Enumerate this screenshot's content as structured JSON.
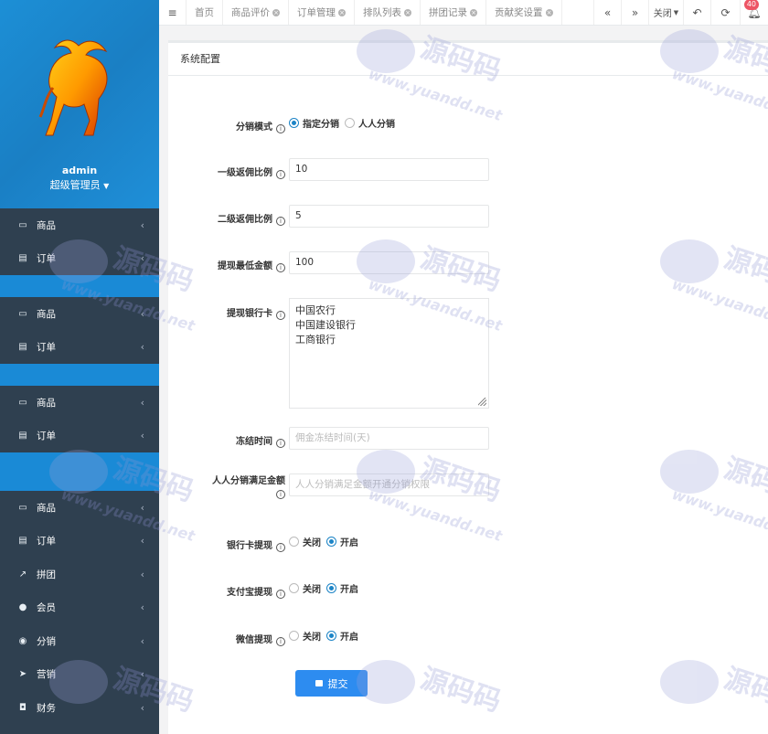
{
  "user": {
    "name": "admin",
    "role": "超级管理员"
  },
  "sidebar": {
    "groups": [
      [
        {
          "icon": "laptop-icon",
          "label": "商品"
        },
        {
          "icon": "list-icon",
          "label": "订单"
        }
      ],
      [
        {
          "icon": "laptop-icon",
          "label": "商品"
        },
        {
          "icon": "list-icon",
          "label": "订单"
        }
      ],
      [
        {
          "icon": "laptop-icon",
          "label": "商品"
        },
        {
          "icon": "list-icon",
          "label": "订单"
        }
      ],
      [
        {
          "icon": "laptop-icon",
          "label": "商品"
        },
        {
          "icon": "list-icon",
          "label": "订单"
        },
        {
          "icon": "chart-icon",
          "label": "拼团"
        },
        {
          "icon": "user-icon",
          "label": "会员"
        },
        {
          "icon": "users-icon",
          "label": "分销"
        },
        {
          "icon": "send-icon",
          "label": "营销"
        },
        {
          "icon": "wallet-icon",
          "label": "财务"
        }
      ]
    ]
  },
  "topbar": {
    "tabs": [
      {
        "label": "首页",
        "closable": false
      },
      {
        "label": "商品评价",
        "closable": true
      },
      {
        "label": "订单管理",
        "closable": true
      },
      {
        "label": "排队列表",
        "closable": true
      },
      {
        "label": "拼团记录",
        "closable": true
      },
      {
        "label": "贡献奖设置",
        "closable": true
      }
    ],
    "close_label": "关闭",
    "notification_count": "40"
  },
  "panel": {
    "title": "系统配置",
    "info_glyph": "i",
    "fields": {
      "mode": {
        "label": "分销模式",
        "options": [
          "指定分销",
          "人人分销"
        ],
        "selected": 0
      },
      "level1": {
        "label": "一级返佣比例",
        "value": "10"
      },
      "level2": {
        "label": "二级返佣比例",
        "value": "5"
      },
      "min_withdraw": {
        "label": "提现最低金额",
        "value": "100"
      },
      "banks": {
        "label": "提现银行卡",
        "value": "中国农行\n中国建设银行\n工商银行"
      },
      "freeze": {
        "label": "冻结时间",
        "placeholder": "佣金冻结时间(天)"
      },
      "all_threshold": {
        "label": "人人分销满足金额",
        "placeholder": "人人分销满足金额开通分销权限"
      },
      "bank_withdraw": {
        "label": "银行卡提现",
        "options": [
          "关闭",
          "开启"
        ],
        "selected": 1
      },
      "alipay_withdraw": {
        "label": "支付宝提现",
        "options": [
          "关闭",
          "开启"
        ],
        "selected": 1
      },
      "wechat_withdraw": {
        "label": "微信提现",
        "options": [
          "关闭",
          "开启"
        ],
        "selected": 1
      }
    },
    "submit_label": "提交"
  },
  "watermark": {
    "text": "源码码",
    "url": "www.yuandd.net"
  }
}
